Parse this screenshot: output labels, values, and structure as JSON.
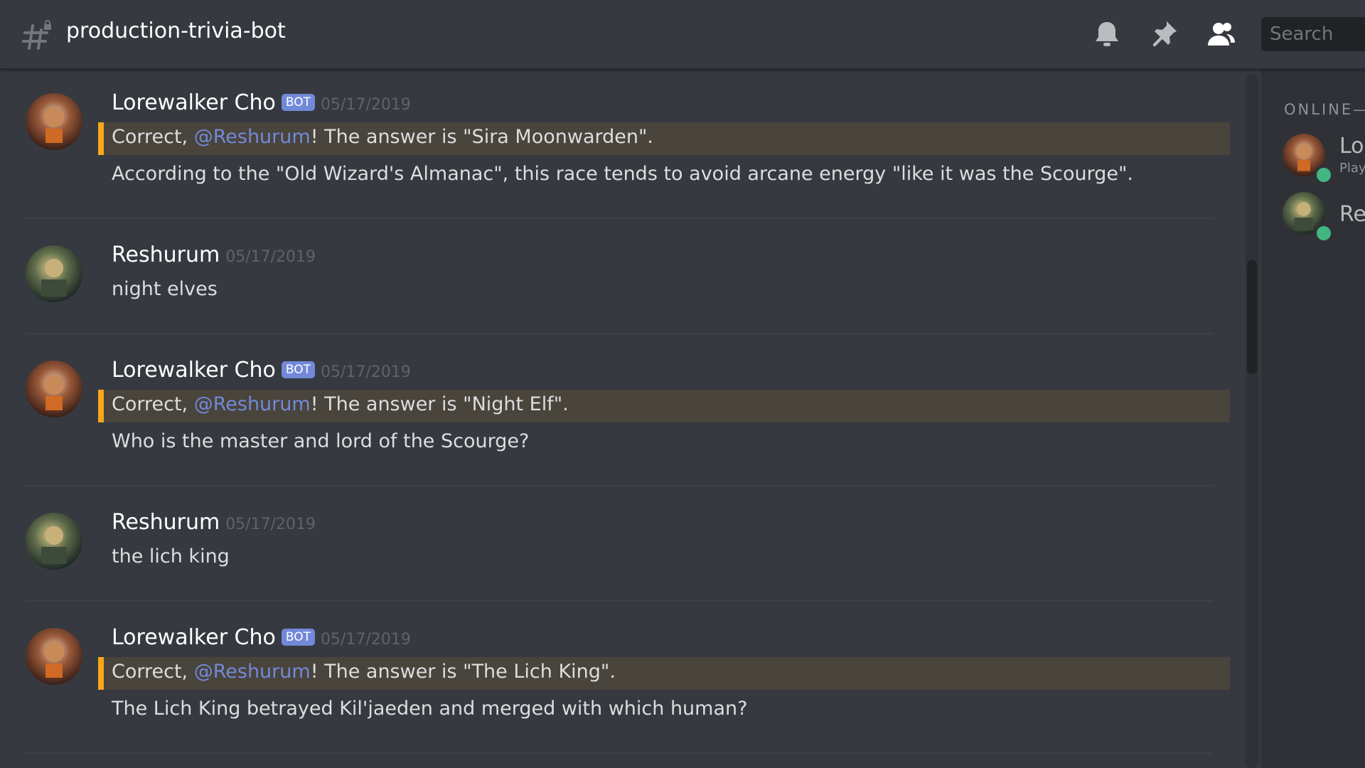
{
  "channel": {
    "name": "production-trivia-bot"
  },
  "header": {
    "search_placeholder": "Search"
  },
  "messages": [
    {
      "author": "Lorewalker Cho",
      "bot_tag": "BOT",
      "timestamp": "05/17/2019",
      "highlight": {
        "prefix": "Correct, ",
        "mention": "@Reshurum",
        "suffix": "! The answer is \"Sira Moonwarden\"."
      },
      "body": "According to the \"Old Wizard's Almanac\", this race tends to avoid arcane energy \"like it was the Scourge\"."
    },
    {
      "author": "Reshurum",
      "timestamp": "05/17/2019",
      "body": "night elves"
    },
    {
      "author": "Lorewalker Cho",
      "bot_tag": "BOT",
      "timestamp": "05/17/2019",
      "highlight": {
        "prefix": "Correct, ",
        "mention": "@Reshurum",
        "suffix": "! The answer is \"Night Elf\"."
      },
      "body": "Who is the master and lord of the Scourge?"
    },
    {
      "author": "Reshurum",
      "timestamp": "05/17/2019",
      "body": "the lich king"
    },
    {
      "author": "Lorewalker Cho",
      "bot_tag": "BOT",
      "timestamp": "05/17/2019",
      "highlight": {
        "prefix": "Correct, ",
        "mention": "@Reshurum",
        "suffix": "! The answer is \"The Lich King\"."
      },
      "body": "The Lich King betrayed Kil'jaeden and merged with which human?"
    }
  ],
  "members": {
    "header": "ONLINE—",
    "list": [
      {
        "name": "Lor",
        "activity": "Play"
      },
      {
        "name": "Re",
        "activity": ""
      }
    ]
  },
  "colors": {
    "accent": "#7289da",
    "highlight_border": "#faa61a",
    "online": "#43b581"
  }
}
